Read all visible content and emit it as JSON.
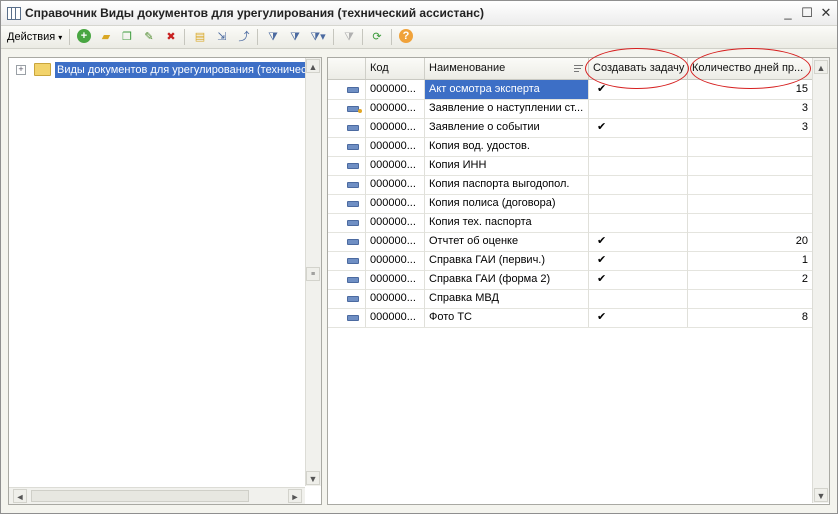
{
  "window": {
    "title": "Справочник Виды документов для урегулирования (технический ассистанс)",
    "controls": {
      "minimize": "_",
      "maximize": "☐",
      "close": "✕"
    }
  },
  "toolbar": {
    "actions_label": "Действия",
    "buttons": [
      {
        "icon": "add-icon",
        "glyph": "+",
        "color": "#3a9a3a"
      },
      {
        "icon": "add-folder-icon",
        "glyph": "▰",
        "color": "#d9a723"
      },
      {
        "icon": "copy-icon",
        "glyph": "❐",
        "color": "#3a9a3a"
      },
      {
        "icon": "edit-icon",
        "glyph": "✎",
        "color": "#4c8a2c"
      },
      {
        "icon": "delete-icon",
        "glyph": "✖",
        "color": "#c82020"
      },
      {
        "icon": "hierarchy-icon",
        "glyph": "▤",
        "color": "#d9a723"
      },
      {
        "icon": "move-icon",
        "glyph": "⇲",
        "color": "#4b6aa0"
      },
      {
        "icon": "level-up-icon",
        "glyph": "⤴",
        "color": "#4b6aa0"
      },
      {
        "icon": "filter-icon",
        "glyph": "⧩",
        "color": "#4b6aa0"
      },
      {
        "icon": "filter-value-icon",
        "glyph": "⧩",
        "color": "#4b6aa0"
      },
      {
        "icon": "filter-list-icon",
        "glyph": "⧩▾",
        "color": "#4b6aa0"
      },
      {
        "icon": "filter-off-icon",
        "glyph": "⧩",
        "color": "#b0b0b0"
      },
      {
        "icon": "refresh-icon",
        "glyph": "⟳",
        "color": "#3a9a3a"
      },
      {
        "icon": "help-icon",
        "glyph": "?",
        "color": "#d97a12"
      }
    ]
  },
  "tree": {
    "expander": "+",
    "root_label": "Виды документов для урегулирования (техническ"
  },
  "grid": {
    "columns": [
      "",
      "Код",
      "Наименование",
      "Создавать задачу",
      "Количество дней пр..."
    ],
    "rows": [
      {
        "code": "000000...",
        "name": "Акт осмотра эксперта",
        "task": "✔",
        "days": "15",
        "selected": true,
        "marked": false
      },
      {
        "code": "000000...",
        "name": "Заявление о наступлении ст...",
        "task": "",
        "days": "3",
        "selected": false,
        "marked": true
      },
      {
        "code": "000000...",
        "name": "Заявление о событии",
        "task": "✔",
        "days": "3",
        "selected": false,
        "marked": false
      },
      {
        "code": "000000...",
        "name": "Копия вод. удостов.",
        "task": "",
        "days": "",
        "selected": false,
        "marked": false
      },
      {
        "code": "000000...",
        "name": "Копия ИНН",
        "task": "",
        "days": "",
        "selected": false,
        "marked": false
      },
      {
        "code": "000000...",
        "name": "Копия паспорта выгодопол.",
        "task": "",
        "days": "",
        "selected": false,
        "marked": false
      },
      {
        "code": "000000...",
        "name": "Копия полиса (договора)",
        "task": "",
        "days": "",
        "selected": false,
        "marked": false
      },
      {
        "code": "000000...",
        "name": "Копия тех. паспорта",
        "task": "",
        "days": "",
        "selected": false,
        "marked": false
      },
      {
        "code": "000000...",
        "name": "Отчтет об оценке",
        "task": "✔",
        "days": "20",
        "selected": false,
        "marked": false
      },
      {
        "code": "000000...",
        "name": "Справка ГАИ (первич.)",
        "task": "✔",
        "days": "1",
        "selected": false,
        "marked": false
      },
      {
        "code": "000000...",
        "name": "Справка ГАИ (форма 2)",
        "task": "✔",
        "days": "2",
        "selected": false,
        "marked": false
      },
      {
        "code": "000000...",
        "name": "Справка МВД",
        "task": "",
        "days": "",
        "selected": false,
        "marked": false
      },
      {
        "code": "000000...",
        "name": "Фото ТС",
        "task": "✔",
        "days": "8",
        "selected": false,
        "marked": false
      }
    ]
  },
  "scroll": {
    "up": "▲",
    "down": "▼",
    "left": "◄",
    "right": "►",
    "grip": "≡"
  },
  "annotation_color": "#d62020"
}
